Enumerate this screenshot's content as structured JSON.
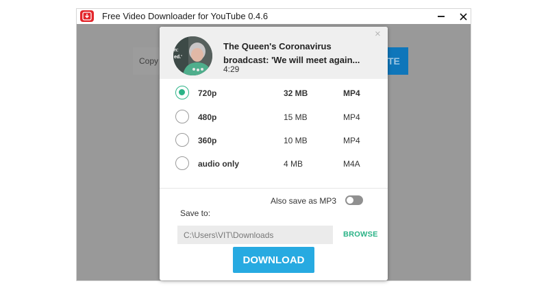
{
  "window": {
    "title": "Free Video Downloader for YouTube 0.4.6",
    "minimize_glyph": "—",
    "close_glyph": "✕"
  },
  "background": {
    "input_text": "Copy",
    "button_text": "TE"
  },
  "dialog": {
    "close_glyph": "×",
    "video": {
      "title_line1": "The Queen's Coronavirus",
      "title_line2": "broadcast: 'We will meet again...",
      "duration": "4:29",
      "thumb_text_1": "n:",
      "thumb_text_2": "ed.'"
    },
    "options": [
      {
        "resolution": "720p",
        "size": "32 MB",
        "format": "MP4",
        "selected": true
      },
      {
        "resolution": "480p",
        "size": "15 MB",
        "format": "MP4",
        "selected": false
      },
      {
        "resolution": "360p",
        "size": "10 MB",
        "format": "MP4",
        "selected": false
      },
      {
        "resolution": "audio only",
        "size": "4 MB",
        "format": "M4A",
        "selected": false
      }
    ],
    "mp3": {
      "label": "Also save as MP3",
      "enabled": false
    },
    "save": {
      "label": "Save to:",
      "path": "C:\\Users\\VIT\\Downloads",
      "browse_label": "BROWSE"
    },
    "download_label": "DOWNLOAD"
  },
  "colors": {
    "accent_green": "#2bb387",
    "download_blue": "#27aae1",
    "app_red": "#e3262b",
    "overlay_gray": "#999999"
  },
  "icons": {
    "app": "download-arrow-icon",
    "minimize": "minimize-icon",
    "close": "close-icon"
  }
}
